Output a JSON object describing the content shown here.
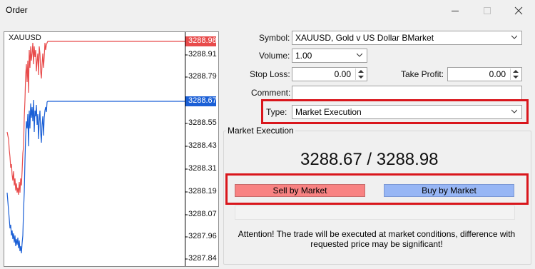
{
  "window": {
    "title": "Order"
  },
  "chart": {
    "symbol_label": "XAUUSD",
    "ask_price_tag": "3288.98",
    "bid_price_tag": "3288.67",
    "ask_color": "#e84b4b",
    "bid_color": "#1a5fd6",
    "price_axis": [
      "3288.91",
      "3288.79",
      "3288.55",
      "3288.43",
      "3288.31",
      "3288.19",
      "3288.07",
      "3287.96",
      "3287.84"
    ]
  },
  "form": {
    "symbol_label": "Symbol:",
    "symbol_value": "XAUUSD, Gold v US Dollar BMarket",
    "volume_label": "Volume:",
    "volume_value": "1.00",
    "stop_loss_label": "Stop Loss:",
    "stop_loss_value": "0.00",
    "take_profit_label": "Take Profit:",
    "take_profit_value": "0.00",
    "comment_label": "Comment:",
    "comment_value": "",
    "type_label": "Type:",
    "type_value": "Market Execution"
  },
  "execution": {
    "group_title": "Market Execution",
    "prices": "3288.67 / 3288.98",
    "sell_label": "Sell by Market",
    "buy_label": "Buy by Market",
    "attention_line1": "Attention! The trade will be executed at market conditions, difference with",
    "attention_line2": "requested price may be significant!"
  },
  "colors": {
    "highlight": "#d9161c",
    "sell": "#f88282",
    "buy": "#97b6f5"
  }
}
